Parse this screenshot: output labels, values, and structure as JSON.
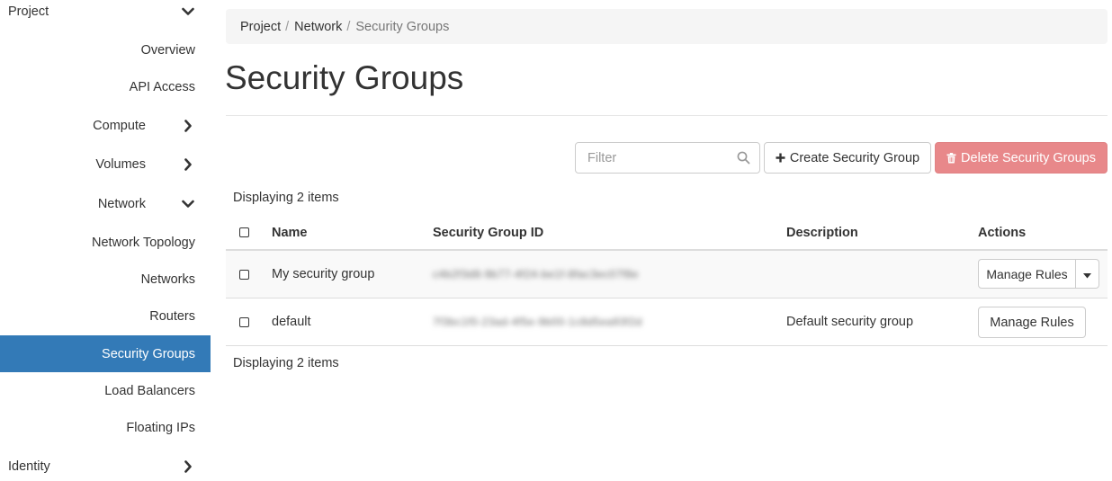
{
  "sidebar": {
    "project": "Project",
    "overview": "Overview",
    "api_access": "API Access",
    "compute": "Compute",
    "volumes": "Volumes",
    "network": "Network",
    "network_topology": "Network Topology",
    "networks": "Networks",
    "routers": "Routers",
    "security_groups": "Security Groups",
    "load_balancers": "Load Balancers",
    "floating_ips": "Floating IPs",
    "identity": "Identity"
  },
  "breadcrumb": {
    "items": [
      "Project",
      "Network",
      "Security Groups"
    ],
    "separator": "/"
  },
  "page_title": "Security Groups",
  "toolbar": {
    "filter_placeholder": "Filter",
    "create_label": "Create Security Group",
    "delete_label": "Delete Security Groups"
  },
  "table": {
    "count_label": "Displaying 2 items",
    "columns": [
      "Name",
      "Security Group ID",
      "Description",
      "Actions"
    ],
    "rows": [
      {
        "name": "My security group",
        "id": "c4b2f3d8-9b77-4f24-be1f-8fac3ec07f8e",
        "description": "",
        "action": "Manage Rules"
      },
      {
        "name": "default",
        "id": "7f3bc1f0-23ad-4f5e-9b00-1c8d5ea93f2d",
        "description": "Default security group",
        "action": "Manage Rules"
      }
    ]
  },
  "colors": {
    "active_nav": "#337ab7",
    "danger_button": "#e8888a"
  }
}
